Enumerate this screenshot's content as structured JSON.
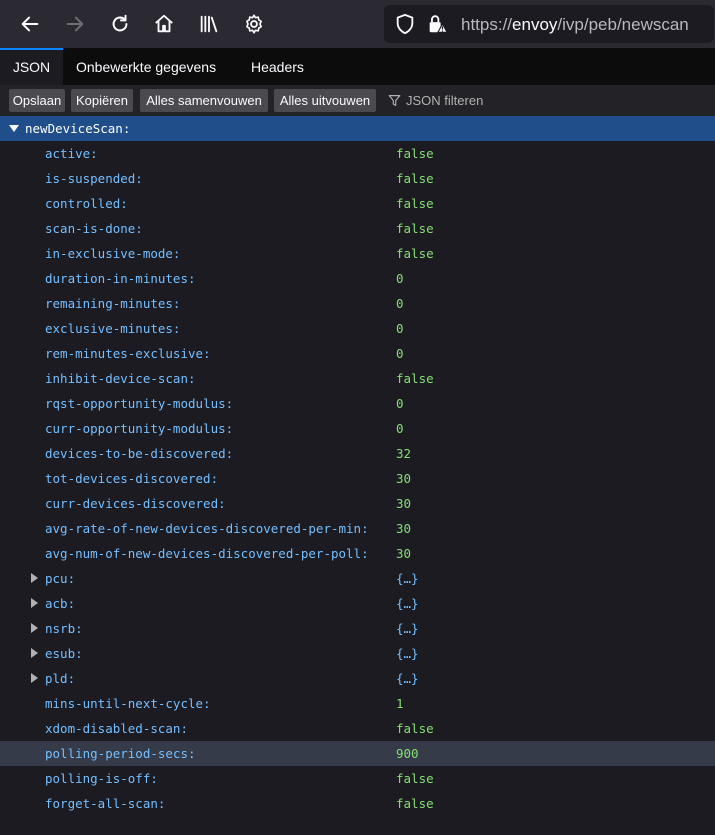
{
  "browser": {
    "url": {
      "protocol": "https://",
      "host": "envoy",
      "path": "/ivp/peb/newscan"
    }
  },
  "tabs": [
    "JSON",
    "Onbewerkte gegevens",
    "Headers"
  ],
  "actions": {
    "save": "Opslaan",
    "copy": "Kopiëren",
    "collapse_all": "Alles samenvouwen",
    "expand_all": "Alles uitvouwen",
    "filter_placeholder": "JSON filteren"
  },
  "tree": {
    "root_key": "newDeviceScan:",
    "rows": [
      {
        "key": "active:",
        "value": "false",
        "type": "bool"
      },
      {
        "key": "is-suspended:",
        "value": "false",
        "type": "bool"
      },
      {
        "key": "controlled:",
        "value": "false",
        "type": "bool"
      },
      {
        "key": "scan-is-done:",
        "value": "false",
        "type": "bool"
      },
      {
        "key": "in-exclusive-mode:",
        "value": "false",
        "type": "bool"
      },
      {
        "key": "duration-in-minutes:",
        "value": "0",
        "type": "num"
      },
      {
        "key": "remaining-minutes:",
        "value": "0",
        "type": "num"
      },
      {
        "key": "exclusive-minutes:",
        "value": "0",
        "type": "num"
      },
      {
        "key": "rem-minutes-exclusive:",
        "value": "0",
        "type": "num"
      },
      {
        "key": "inhibit-device-scan:",
        "value": "false",
        "type": "bool"
      },
      {
        "key": "rqst-opportunity-modulus:",
        "value": "0",
        "type": "num"
      },
      {
        "key": "curr-opportunity-modulus:",
        "value": "0",
        "type": "num"
      },
      {
        "key": "devices-to-be-discovered:",
        "value": "32",
        "type": "num"
      },
      {
        "key": "tot-devices-discovered:",
        "value": "30",
        "type": "num"
      },
      {
        "key": "curr-devices-discovered:",
        "value": "30",
        "type": "num"
      },
      {
        "key": "avg-rate-of-new-devices-discovered-per-min:",
        "value": "30",
        "type": "num"
      },
      {
        "key": "avg-num-of-new-devices-discovered-per-poll:",
        "value": "30",
        "type": "num"
      },
      {
        "key": "pcu:",
        "value": "{…}",
        "type": "obj"
      },
      {
        "key": "acb:",
        "value": "{…}",
        "type": "obj"
      },
      {
        "key": "nsrb:",
        "value": "{…}",
        "type": "obj"
      },
      {
        "key": "esub:",
        "value": "{…}",
        "type": "obj"
      },
      {
        "key": "pld:",
        "value": "{…}",
        "type": "obj"
      },
      {
        "key": "mins-until-next-cycle:",
        "value": "1",
        "type": "num"
      },
      {
        "key": "xdom-disabled-scan:",
        "value": "false",
        "type": "bool"
      },
      {
        "key": "polling-period-secs:",
        "value": "900",
        "type": "num",
        "selected": true
      },
      {
        "key": "polling-is-off:",
        "value": "false",
        "type": "bool"
      },
      {
        "key": "forget-all-scan:",
        "value": "false",
        "type": "bool"
      }
    ]
  }
}
